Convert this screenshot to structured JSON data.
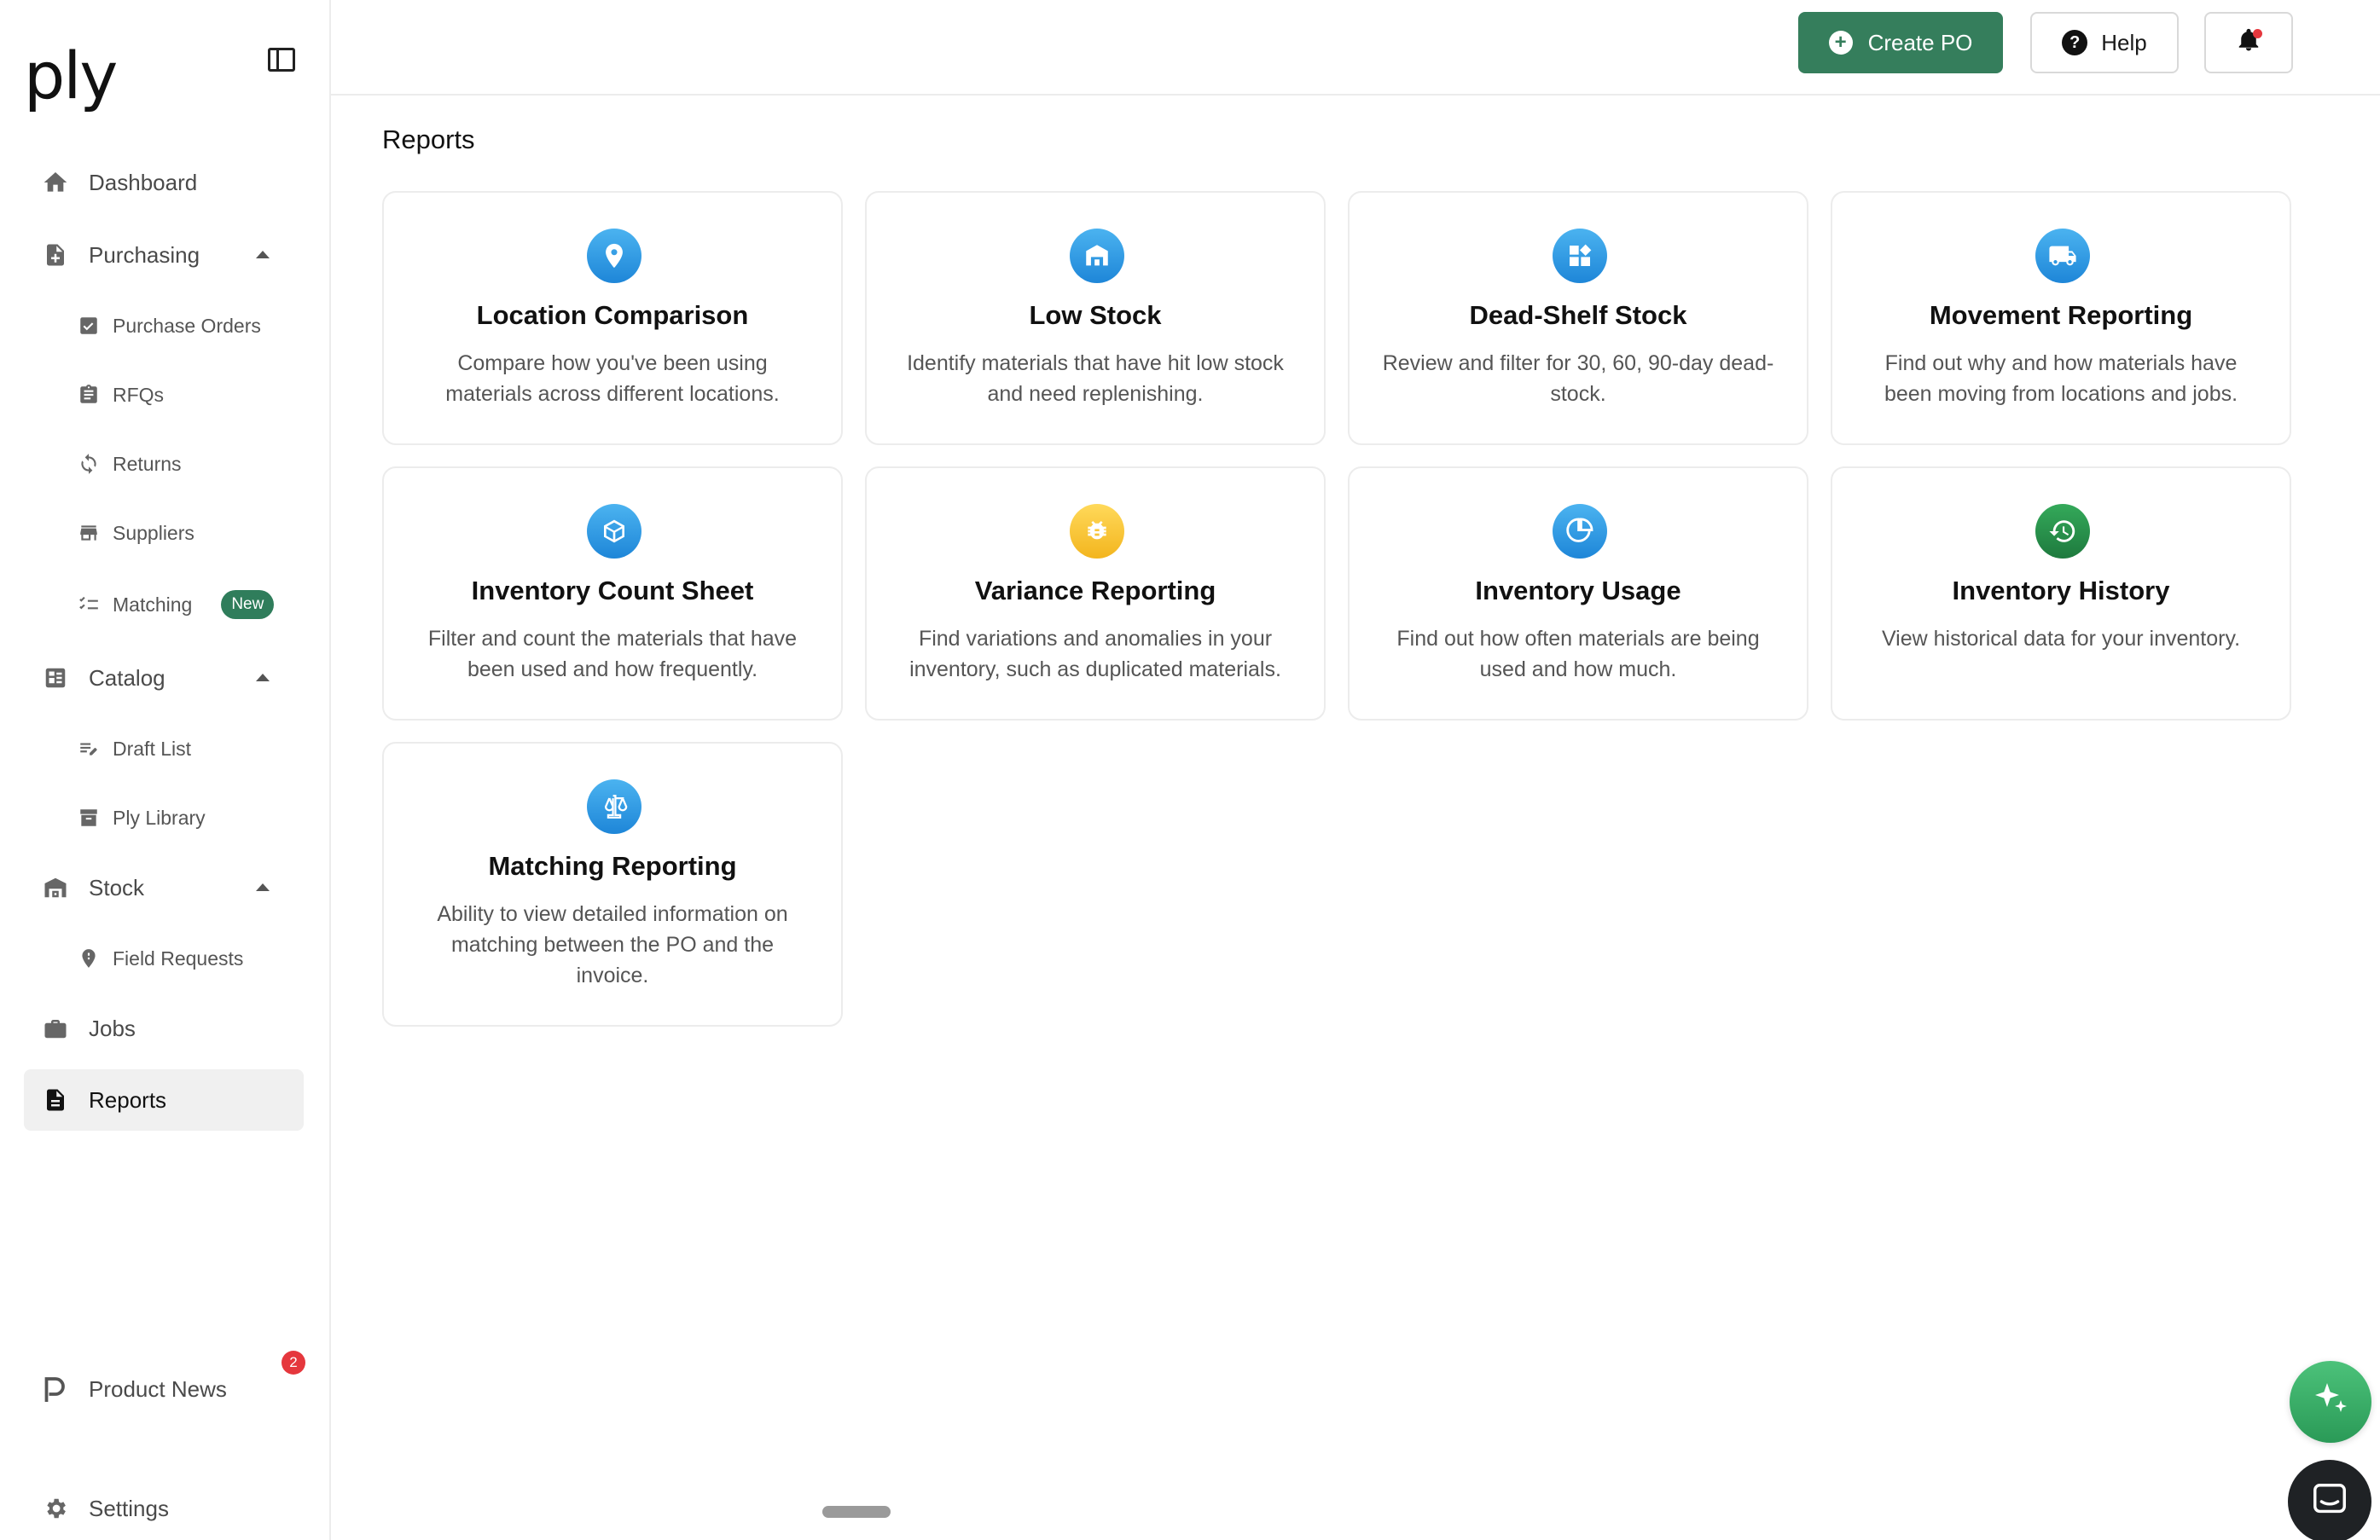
{
  "brand": {
    "logo_text": "ply"
  },
  "sidebar": {
    "items": [
      {
        "label": "Dashboard"
      },
      {
        "label": "Purchasing"
      },
      {
        "label": "Catalog"
      },
      {
        "label": "Stock"
      },
      {
        "label": "Jobs"
      },
      {
        "label": "Reports"
      }
    ],
    "purchasing_sub": [
      {
        "label": "Purchase Orders"
      },
      {
        "label": "RFQs"
      },
      {
        "label": "Returns"
      },
      {
        "label": "Suppliers"
      },
      {
        "label": "Matching",
        "badge": "New"
      }
    ],
    "catalog_sub": [
      {
        "label": "Draft List"
      },
      {
        "label": "Ply Library"
      }
    ],
    "stock_sub": [
      {
        "label": "Field Requests"
      }
    ],
    "product_news": {
      "label": "Product News",
      "count": "2"
    },
    "settings": {
      "label": "Settings"
    },
    "active": "Reports"
  },
  "topbar": {
    "create_po_label": "Create PO",
    "help_label": "Help"
  },
  "main": {
    "title": "Reports",
    "cards": [
      {
        "title": "Location Comparison",
        "desc": "Compare how you've been using materials across different locations.",
        "icon": "location-pin-icon",
        "color": "blue"
      },
      {
        "title": "Low Stock",
        "desc": "Identify materials that have hit low stock and need replenishing.",
        "icon": "warehouse-icon",
        "color": "blue"
      },
      {
        "title": "Dead-Shelf Stock",
        "desc": "Review and filter for 30, 60, 90-day dead-stock.",
        "icon": "widgets-icon",
        "color": "blue"
      },
      {
        "title": "Movement Reporting",
        "desc": "Find out why and how materials have been moving from locations and jobs.",
        "icon": "truck-icon",
        "color": "blue"
      },
      {
        "title": "Inventory Count Sheet",
        "desc": "Filter and count the materials that have been used and how frequently.",
        "icon": "cube-icon",
        "color": "blue"
      },
      {
        "title": "Variance Reporting",
        "desc": "Find variations and anomalies in your inventory, such as duplicated materials.",
        "icon": "bug-icon",
        "color": "yellow"
      },
      {
        "title": "Inventory Usage",
        "desc": "Find out how often materials are being used and how much.",
        "icon": "pie-chart-icon",
        "color": "blue"
      },
      {
        "title": "Inventory History",
        "desc": "View historical data for your inventory.",
        "icon": "history-icon",
        "color": "green"
      },
      {
        "title": "Matching Reporting",
        "desc": "Ability to view detailed information on matching between the PO and the invoice.",
        "icon": "scale-icon",
        "color": "blue"
      }
    ]
  }
}
